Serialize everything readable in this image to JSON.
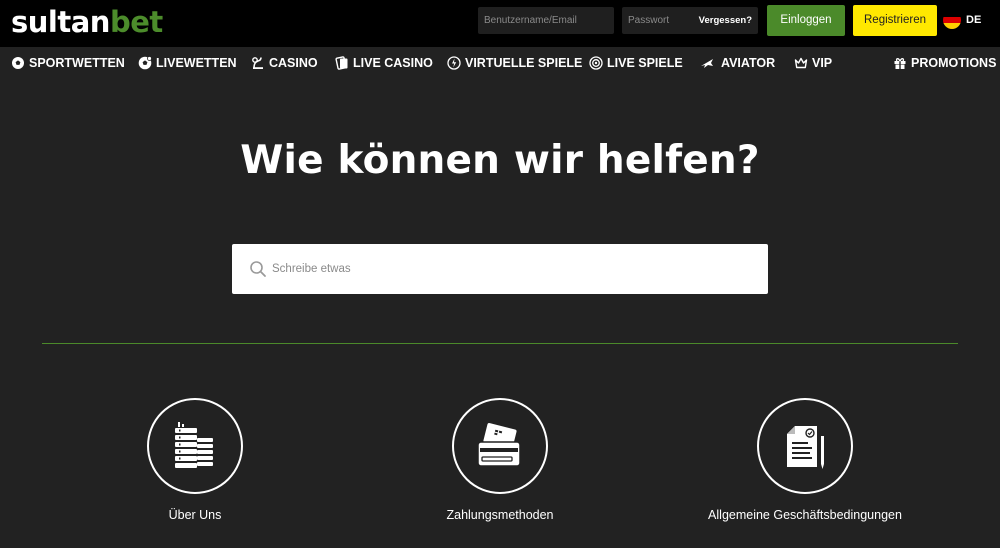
{
  "header": {
    "logo": {
      "part1": "sultan",
      "part2": "bet"
    },
    "username_placeholder": "Benutzername/Email",
    "password_placeholder": "Passwort",
    "forgot_label": "Vergessen?",
    "login_label": "Einloggen",
    "register_label": "Registrieren",
    "language": "DE"
  },
  "nav": {
    "items": [
      {
        "label": "SPORTWETTEN",
        "icon": "soccer-ball-icon"
      },
      {
        "label": "LIVEWETTEN",
        "icon": "live-ball-icon"
      },
      {
        "label": "CASINO",
        "icon": "casino-icon"
      },
      {
        "label": "LIVE CASINO",
        "icon": "live-casino-icon"
      },
      {
        "label": "VIRTUELLE SPIELE",
        "icon": "virtual-games-icon"
      },
      {
        "label": "LIVE SPIELE",
        "icon": "live-games-icon"
      },
      {
        "label": "AVIATOR",
        "icon": "plane-icon"
      },
      {
        "label": "VIP",
        "icon": "crown-icon"
      }
    ],
    "promotions": {
      "label": "PROMOTIONS",
      "icon": "gift-icon"
    }
  },
  "hero": {
    "title": "Wie können wir helfen?",
    "search_placeholder": "Schreibe etwas"
  },
  "categories": [
    {
      "label": "Über Uns",
      "icon": "buildings-icon"
    },
    {
      "label": "Zahlungsmethoden",
      "icon": "payment-cards-icon"
    },
    {
      "label": "Allgemeine Geschäftsbedingungen",
      "icon": "terms-document-icon"
    }
  ],
  "colors": {
    "brand_green": "#4b8a2a",
    "register_yellow": "#ffe800",
    "background": "#222222",
    "topbar": "#000000"
  }
}
